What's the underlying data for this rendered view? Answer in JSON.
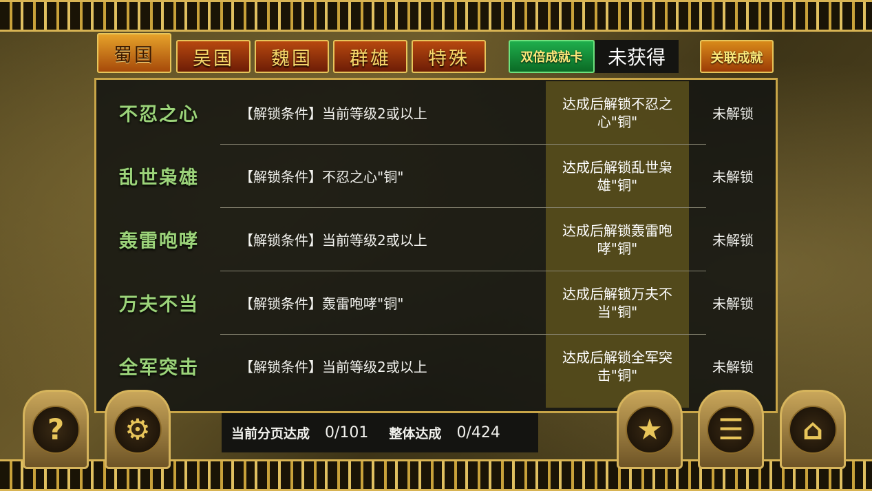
{
  "tabs": [
    {
      "label": "蜀国",
      "active": true
    },
    {
      "label": "吴国",
      "active": false
    },
    {
      "label": "魏国",
      "active": false
    },
    {
      "label": "群雄",
      "active": false
    },
    {
      "label": "特殊",
      "active": false
    }
  ],
  "double_card": {
    "label": "双倍成就卡",
    "status": "未获得"
  },
  "related_label": "关联成就",
  "achievements": [
    {
      "name": "不忍之心",
      "condition": "【解锁条件】当前等级2或以上",
      "reward": "达成后解锁不忍之心\"铜\"",
      "state": "未解锁"
    },
    {
      "name": "乱世枭雄",
      "condition": "【解锁条件】不忍之心\"铜\"",
      "reward": "达成后解锁乱世枭雄\"铜\"",
      "state": "未解锁"
    },
    {
      "name": "轰雷咆哮",
      "condition": "【解锁条件】当前等级2或以上",
      "reward": "达成后解锁轰雷咆哮\"铜\"",
      "state": "未解锁"
    },
    {
      "name": "万夫不当",
      "condition": "【解锁条件】轰雷咆哮\"铜\"",
      "reward": "达成后解锁万夫不当\"铜\"",
      "state": "未解锁"
    },
    {
      "name": "全军突击",
      "condition": "【解锁条件】当前等级2或以上",
      "reward": "达成后解锁全军突击\"铜\"",
      "state": "未解锁"
    }
  ],
  "progress": {
    "page_label": "当前分页达成",
    "page_value": "0/101",
    "total_label": "整体达成",
    "total_value": "0/424"
  },
  "buttons": {
    "help_glyph": "?",
    "settings_glyph": "⚙",
    "rank_glyph": "★",
    "list_glyph": "☰",
    "home_glyph": "⌂"
  },
  "colors": {
    "accent_gold": "#e8c55a",
    "name_green": "#9cd37a",
    "double_card_green": "#1fae4c"
  }
}
